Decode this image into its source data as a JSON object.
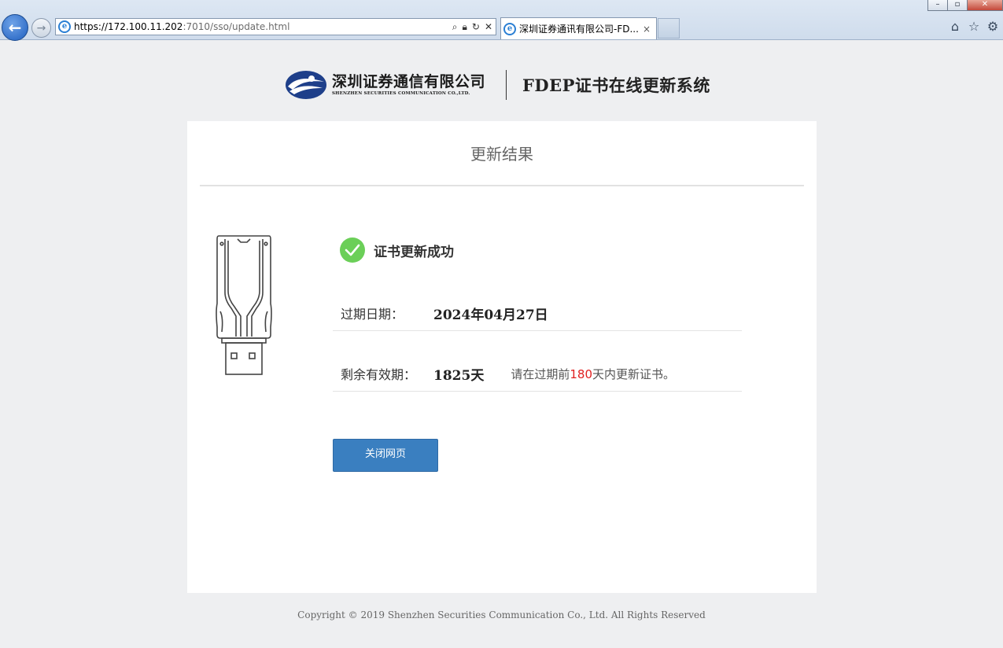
{
  "browser": {
    "url_main": "https://172.100.11.202",
    "url_rest": ":7010/sso/update.html",
    "tab_title": "深圳证券通讯有限公司-FD...",
    "tab_close": "×"
  },
  "header": {
    "company_cn": "深圳证券通信有限公司",
    "company_en": "SHENZHEN SECURITIES COMMUNICATION CO.,LTD.",
    "system_title": "FDEP证书在线更新系统"
  },
  "card": {
    "title": "更新结果",
    "success_text": "证书更新成功",
    "expiry_label": "过期日期：",
    "expiry_value": "2024年04月27日",
    "remaining_label": "剩余有效期：",
    "remaining_value": "1825天",
    "note_prefix": "请在过期前",
    "note_days": "180",
    "note_suffix": "天内更新证书。",
    "close_button": "关闭网页"
  },
  "footer": {
    "copyright": "Copyright © 2019 Shenzhen Securities Communication Co., Ltd. All Rights Reserved"
  },
  "colors": {
    "accent_button": "#3a7fc0",
    "success_green": "#6bcf58",
    "highlight_red": "#e02020"
  }
}
